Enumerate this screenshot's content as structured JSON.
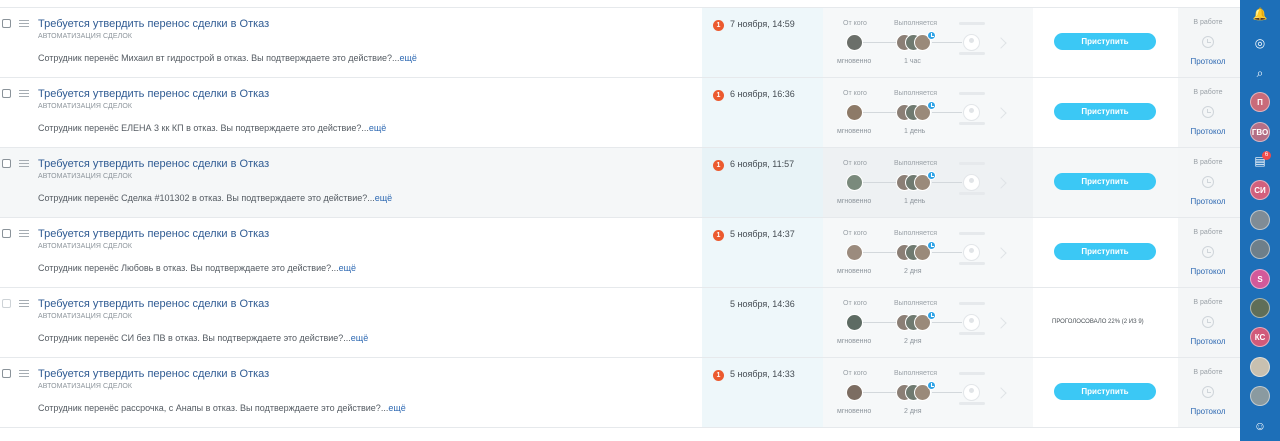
{
  "labels": {
    "from": "От кого",
    "executing": "Выполняется",
    "instant": "мгновенно",
    "in_work": "В работе",
    "protocol": "Протокол",
    "start_button": "Приступить",
    "more": "ещё"
  },
  "rows": [
    {
      "title": "Требуется утвердить перенос сделки в Отказ",
      "subtitle": "АВТОМАТИЗАЦИЯ СДЕЛОК",
      "description": "Сотрудник  перенёс Михаил вт гидрострой в отказ. Вы подтверждаете это действие?...",
      "badge": "1",
      "date": "7 ноября, 14:59",
      "duration": "1 час",
      "action": "button"
    },
    {
      "title": "Требуется утвердить перенос сделки в Отказ",
      "subtitle": "АВТОМАТИЗАЦИЯ СДЕЛОК",
      "description": "Сотрудник  перенёс ЕЛЕНА 3 кк КП в отказ. Вы подтверждаете это действие?...",
      "badge": "1",
      "date": "6 ноября, 16:36",
      "duration": "1 день",
      "action": "button"
    },
    {
      "title": "Требуется утвердить перенос сделки в Отказ",
      "subtitle": "АВТОМАТИЗАЦИЯ СДЕЛОК",
      "description": "Сотрудник  перенёс Сделка #101302 в отказ. Вы подтверждаете это действие?...",
      "badge": "1",
      "date": "6 ноября, 11:57",
      "duration": "1 день",
      "action": "button"
    },
    {
      "title": "Требуется утвердить перенос сделки в Отказ",
      "subtitle": "АВТОМАТИЗАЦИЯ СДЕЛОК",
      "description": "Сотрудник  перенёс Любовь в отказ. Вы подтверждаете это действие?...",
      "badge": "1",
      "date": "5 ноября, 14:37",
      "duration": "2 дня",
      "action": "button"
    },
    {
      "title": "Требуется утвердить перенос сделки в Отказ",
      "subtitle": "АВТОМАТИЗАЦИЯ СДЕЛОК",
      "description": "Сотрудник  перенёс СИ без ПВ в отказ. Вы подтверждаете это действие?...",
      "badge": "",
      "date": "5 ноября, 14:36",
      "duration": "2 дня",
      "action": "voted",
      "voted_text": "ПРОГОЛОСОВАЛО 22% (2 ИЗ 9)"
    },
    {
      "title": "Требуется утвердить перенос сделки в Отказ",
      "subtitle": "АВТОМАТИЗАЦИЯ СДЕЛОК",
      "description": "Сотрудник  перенёс рассрочка, с Анапы в отказ. Вы подтверждаете это действие?...",
      "badge": "1",
      "date": "5 ноября, 14:33",
      "duration": "2 дня",
      "action": "button"
    }
  ],
  "sidebar": {
    "items": [
      {
        "icon": "bell-icon"
      },
      {
        "icon": "chat-bubble-icon"
      },
      {
        "icon": "search-icon"
      },
      {
        "initials": "П",
        "color": "#c96b7a"
      },
      {
        "initials": "ГВО",
        "color": "#b56f86"
      },
      {
        "icon": "chat-icon",
        "badge": "6"
      },
      {
        "initials": "СИ",
        "color": "#d2607d"
      },
      {
        "photo": true,
        "color": "#7f8c96"
      },
      {
        "photo": true,
        "color": "#6e7f8a"
      },
      {
        "initials": "S",
        "color": "#d3599a"
      },
      {
        "photo": true,
        "color": "#5f6e58"
      },
      {
        "initials": "КС",
        "color": "#d15a7a"
      },
      {
        "photo": true,
        "color": "#c8c0b0"
      },
      {
        "photo": true,
        "color": "#8a9aa0"
      },
      {
        "icon": "users-icon"
      }
    ]
  }
}
